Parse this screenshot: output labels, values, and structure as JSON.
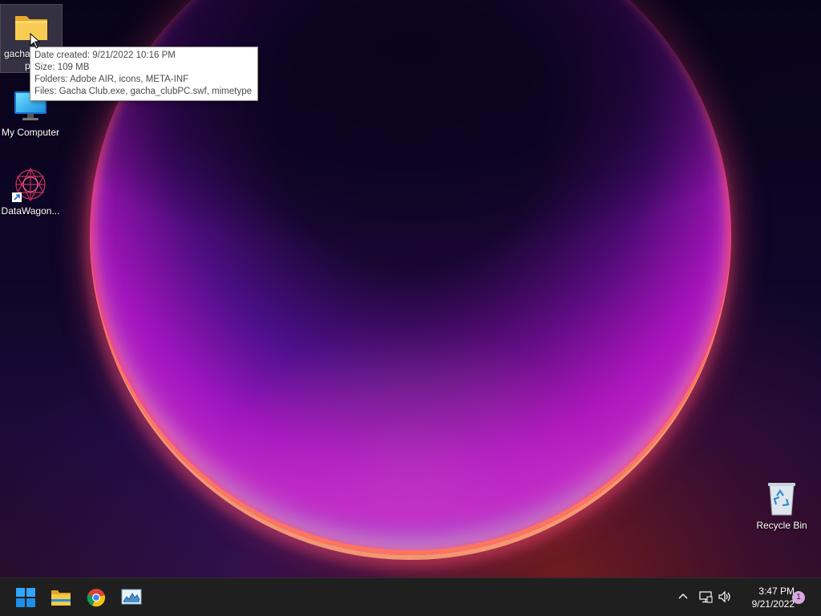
{
  "desktop": {
    "icons": [
      {
        "label": "gacha",
        "label_line2": "p"
      },
      {
        "label": "My Computer"
      },
      {
        "label": "DataWagon..."
      },
      {
        "label": "Recycle Bin"
      }
    ]
  },
  "tooltip": {
    "date_created": "Date created: 9/21/2022 10:16 PM",
    "size": "Size: 109 MB",
    "folders": "Folders: Adobe AIR, icons, META-INF",
    "files": "Files: Gacha Club.exe, gacha_clubPC.swf, mimetype"
  },
  "taskbar": {
    "apps": [
      {
        "icon": "windows-start-icon"
      },
      {
        "icon": "file-explorer-icon"
      },
      {
        "icon": "chrome-icon"
      },
      {
        "icon": "task-manager-icon"
      }
    ],
    "tray": {
      "icons": [
        "chevron-up-icon",
        "network-icon",
        "volume-icon"
      ]
    },
    "clock": {
      "time": "3:47 PM",
      "date": "9/21/2022"
    },
    "notification_count": "1"
  },
  "colors": {
    "taskbar_bg": "#1f1f1f",
    "tooltip_bg": "#ffffff",
    "windows_blue": "#1e90ff",
    "folder_yellow": "#f7c948"
  }
}
